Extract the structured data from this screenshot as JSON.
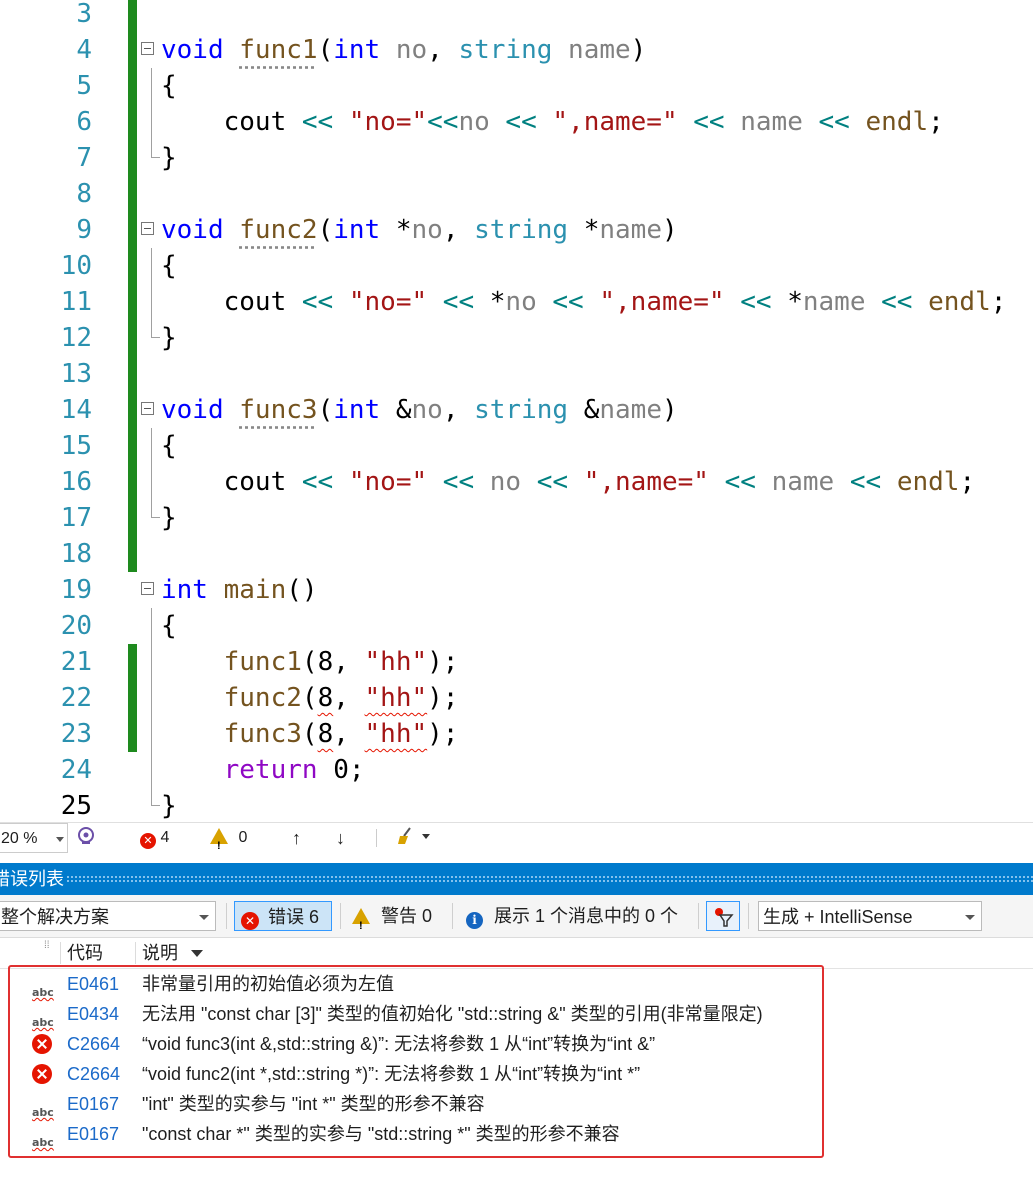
{
  "editor": {
    "lines": [
      {
        "num": "3",
        "segs": []
      },
      {
        "num": "4",
        "segs": [
          {
            "t": "void",
            "c": "kw"
          },
          {
            "t": " ",
            "c": "nm"
          },
          {
            "t": "func1",
            "c": "fn",
            "d": 1
          },
          {
            "t": "(",
            "c": "nm"
          },
          {
            "t": "int",
            "c": "kw"
          },
          {
            "t": " ",
            "c": "nm"
          },
          {
            "t": "no",
            "c": "pm"
          },
          {
            "t": ", ",
            "c": "nm"
          },
          {
            "t": "string",
            "c": "ty"
          },
          {
            "t": " ",
            "c": "nm"
          },
          {
            "t": "name",
            "c": "pm"
          },
          {
            "t": ")",
            "c": "nm"
          }
        ]
      },
      {
        "num": "5",
        "segs": [
          {
            "t": "{",
            "c": "nm"
          }
        ]
      },
      {
        "num": "6",
        "segs": [
          {
            "t": "    cout ",
            "c": "nm"
          },
          {
            "t": "<<",
            "c": "op"
          },
          {
            "t": " ",
            "c": "nm"
          },
          {
            "t": "\"no=\"",
            "c": "st"
          },
          {
            "t": "<<",
            "c": "op"
          },
          {
            "t": "no",
            "c": "pm"
          },
          {
            "t": " ",
            "c": "nm"
          },
          {
            "t": "<<",
            "c": "op"
          },
          {
            "t": " ",
            "c": "nm"
          },
          {
            "t": "\",name=\"",
            "c": "st"
          },
          {
            "t": " ",
            "c": "nm"
          },
          {
            "t": "<<",
            "c": "op"
          },
          {
            "t": " ",
            "c": "nm"
          },
          {
            "t": "name",
            "c": "pm"
          },
          {
            "t": " ",
            "c": "nm"
          },
          {
            "t": "<<",
            "c": "op"
          },
          {
            "t": " ",
            "c": "nm"
          },
          {
            "t": "endl",
            "c": "fn"
          },
          {
            "t": ";",
            "c": "nm"
          }
        ]
      },
      {
        "num": "7",
        "segs": [
          {
            "t": "}",
            "c": "nm"
          }
        ]
      },
      {
        "num": "8",
        "segs": []
      },
      {
        "num": "9",
        "segs": [
          {
            "t": "void",
            "c": "kw"
          },
          {
            "t": " ",
            "c": "nm"
          },
          {
            "t": "func2",
            "c": "fn",
            "d": 1
          },
          {
            "t": "(",
            "c": "nm"
          },
          {
            "t": "int",
            "c": "kw"
          },
          {
            "t": " *",
            "c": "nm"
          },
          {
            "t": "no",
            "c": "pm"
          },
          {
            "t": ", ",
            "c": "nm"
          },
          {
            "t": "string",
            "c": "ty"
          },
          {
            "t": " *",
            "c": "nm"
          },
          {
            "t": "name",
            "c": "pm"
          },
          {
            "t": ")",
            "c": "nm"
          }
        ]
      },
      {
        "num": "10",
        "segs": [
          {
            "t": "{",
            "c": "nm"
          }
        ]
      },
      {
        "num": "11",
        "segs": [
          {
            "t": "    cout ",
            "c": "nm"
          },
          {
            "t": "<<",
            "c": "op"
          },
          {
            "t": " ",
            "c": "nm"
          },
          {
            "t": "\"no=\"",
            "c": "st"
          },
          {
            "t": " ",
            "c": "nm"
          },
          {
            "t": "<<",
            "c": "op"
          },
          {
            "t": " *",
            "c": "nm"
          },
          {
            "t": "no",
            "c": "pm"
          },
          {
            "t": " ",
            "c": "nm"
          },
          {
            "t": "<<",
            "c": "op"
          },
          {
            "t": " ",
            "c": "nm"
          },
          {
            "t": "\",name=\"",
            "c": "st"
          },
          {
            "t": " ",
            "c": "nm"
          },
          {
            "t": "<<",
            "c": "op"
          },
          {
            "t": " *",
            "c": "nm"
          },
          {
            "t": "name",
            "c": "pm"
          },
          {
            "t": " ",
            "c": "nm"
          },
          {
            "t": "<<",
            "c": "op"
          },
          {
            "t": " ",
            "c": "nm"
          },
          {
            "t": "endl",
            "c": "fn"
          },
          {
            "t": ";",
            "c": "nm"
          }
        ]
      },
      {
        "num": "12",
        "segs": [
          {
            "t": "}",
            "c": "nm"
          }
        ]
      },
      {
        "num": "13",
        "segs": []
      },
      {
        "num": "14",
        "segs": [
          {
            "t": "void",
            "c": "kw"
          },
          {
            "t": " ",
            "c": "nm"
          },
          {
            "t": "func3",
            "c": "fn",
            "d": 1
          },
          {
            "t": "(",
            "c": "nm"
          },
          {
            "t": "int",
            "c": "kw"
          },
          {
            "t": " &",
            "c": "nm"
          },
          {
            "t": "no",
            "c": "pm"
          },
          {
            "t": ", ",
            "c": "nm"
          },
          {
            "t": "string",
            "c": "ty"
          },
          {
            "t": " &",
            "c": "nm"
          },
          {
            "t": "name",
            "c": "pm"
          },
          {
            "t": ")",
            "c": "nm"
          }
        ]
      },
      {
        "num": "15",
        "segs": [
          {
            "t": "{",
            "c": "nm"
          }
        ]
      },
      {
        "num": "16",
        "segs": [
          {
            "t": "    cout ",
            "c": "nm"
          },
          {
            "t": "<<",
            "c": "op"
          },
          {
            "t": " ",
            "c": "nm"
          },
          {
            "t": "\"no=\"",
            "c": "st"
          },
          {
            "t": " ",
            "c": "nm"
          },
          {
            "t": "<<",
            "c": "op"
          },
          {
            "t": " ",
            "c": "nm"
          },
          {
            "t": "no",
            "c": "pm"
          },
          {
            "t": " ",
            "c": "nm"
          },
          {
            "t": "<<",
            "c": "op"
          },
          {
            "t": " ",
            "c": "nm"
          },
          {
            "t": "\",name=\"",
            "c": "st"
          },
          {
            "t": " ",
            "c": "nm"
          },
          {
            "t": "<<",
            "c": "op"
          },
          {
            "t": " ",
            "c": "nm"
          },
          {
            "t": "name",
            "c": "pm"
          },
          {
            "t": " ",
            "c": "nm"
          },
          {
            "t": "<<",
            "c": "op"
          },
          {
            "t": " ",
            "c": "nm"
          },
          {
            "t": "endl",
            "c": "fn"
          },
          {
            "t": ";",
            "c": "nm"
          }
        ]
      },
      {
        "num": "17",
        "segs": [
          {
            "t": "}",
            "c": "nm"
          }
        ]
      },
      {
        "num": "18",
        "segs": []
      },
      {
        "num": "19",
        "segs": [
          {
            "t": "int",
            "c": "kw"
          },
          {
            "t": " ",
            "c": "nm"
          },
          {
            "t": "main",
            "c": "fn"
          },
          {
            "t": "()",
            "c": "nm"
          }
        ]
      },
      {
        "num": "20",
        "segs": [
          {
            "t": "{",
            "c": "nm"
          }
        ]
      },
      {
        "num": "21",
        "segs": [
          {
            "t": "    ",
            "c": "nm"
          },
          {
            "t": "func1",
            "c": "fn"
          },
          {
            "t": "(",
            "c": "nm"
          },
          {
            "t": "8",
            "c": "nm"
          },
          {
            "t": ", ",
            "c": "nm"
          },
          {
            "t": "\"hh\"",
            "c": "st"
          },
          {
            "t": ");",
            "c": "nm"
          }
        ]
      },
      {
        "num": "22",
        "segs": [
          {
            "t": "    ",
            "c": "nm"
          },
          {
            "t": "func2",
            "c": "fn"
          },
          {
            "t": "(",
            "c": "nm"
          },
          {
            "t": "8",
            "c": "nm",
            "s": 1
          },
          {
            "t": ", ",
            "c": "nm"
          },
          {
            "t": "\"hh\"",
            "c": "st",
            "s": 1
          },
          {
            "t": ");",
            "c": "nm"
          }
        ]
      },
      {
        "num": "23",
        "segs": [
          {
            "t": "    ",
            "c": "nm"
          },
          {
            "t": "func3",
            "c": "fn"
          },
          {
            "t": "(",
            "c": "nm"
          },
          {
            "t": "8",
            "c": "nm",
            "s": 1
          },
          {
            "t": ", ",
            "c": "nm"
          },
          {
            "t": "\"hh\"",
            "c": "st",
            "s": 1
          },
          {
            "t": ");",
            "c": "nm"
          }
        ]
      },
      {
        "num": "24",
        "segs": [
          {
            "t": "    ",
            "c": "nm"
          },
          {
            "t": "return",
            "c": "rt"
          },
          {
            "t": " ",
            "c": "nm"
          },
          {
            "t": "0",
            "c": "nm"
          },
          {
            "t": ";",
            "c": "nm"
          }
        ]
      },
      {
        "num": "25",
        "segs": [
          {
            "t": "}",
            "c": "nm"
          }
        ],
        "current": true
      }
    ]
  },
  "status_strip": {
    "zoom": "20 %",
    "error_count": "4",
    "warning_count": "0",
    "up_arrow": "↑",
    "down_arrow": "↓"
  },
  "error_list": {
    "title": "错误列表",
    "scope": "整个解决方案",
    "errors_btn": "错误 6",
    "warnings_btn": "警告 0",
    "messages_btn": "展示 1 个消息中的 0 个",
    "source": "生成 + IntelliSense",
    "col_code": "代码",
    "col_desc": "说明",
    "rows": [
      {
        "icon": "abc",
        "code": "E0461",
        "desc": "非常量引用的初始值必须为左值"
      },
      {
        "icon": "abc",
        "code": "E0434",
        "desc": "无法用 \"const char [3]\" 类型的值初始化 \"std::string &\" 类型的引用(非常量限定)"
      },
      {
        "icon": "error",
        "code": "C2664",
        "desc": "“void func3(int &,std::string &)”: 无法将参数 1 从“int”转换为“int &”"
      },
      {
        "icon": "error",
        "code": "C2664",
        "desc": "“void func2(int *,std::string *)”: 无法将参数 1 从“int”转换为“int *”"
      },
      {
        "icon": "abc",
        "code": "E0167",
        "desc": "\"int\" 类型的实参与 \"int *\" 类型的形参不兼容"
      },
      {
        "icon": "abc",
        "code": "E0167",
        "desc": "\"const char *\" 类型的实参与 \"std::string *\" 类型的形参不兼容"
      }
    ]
  }
}
